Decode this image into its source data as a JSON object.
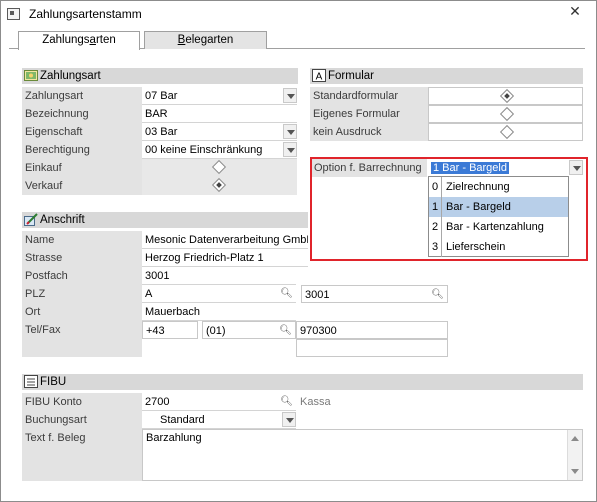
{
  "window": {
    "title": "Zahlungsartenstamm",
    "close": "✕"
  },
  "tabs": [
    {
      "label_pre": "Zahlungs",
      "label_u": "a",
      "label_post": "rten"
    },
    {
      "label_pre": "",
      "label_u": "B",
      "label_post": "elegarten"
    }
  ],
  "zahlungsart": {
    "header": "Zahlungsart",
    "zahlungsart_label": "Zahlungsart",
    "zahlungsart_value": "07 Bar",
    "bezeichnung_label": "Bezeichnung",
    "bezeichnung_value": "BAR",
    "eigenschaft_label": "Eigenschaft",
    "eigenschaft_value": "03 Bar",
    "berechtigung_label": "Berechtigung",
    "berechtigung_value": "00 keine Einschränkung",
    "einkauf_label": "Einkauf",
    "verkauf_label": "Verkauf"
  },
  "formular": {
    "header": "Formular",
    "options": [
      "Standardformular",
      "Eigenes Formular",
      "kein Ausdruck"
    ],
    "selected_index": 0,
    "barrechnung_label": "Option f. Barrechnung",
    "barrechnung_value": "1 Bar - Bargeld",
    "dropdown_items": [
      {
        "num": "0",
        "text": "Zielrechnung"
      },
      {
        "num": "1",
        "text": "Bar - Bargeld"
      },
      {
        "num": "2",
        "text": "Bar - Kartenzahlung"
      },
      {
        "num": "3",
        "text": "Lieferschein"
      }
    ],
    "dropdown_selected_index": 1
  },
  "anschrift": {
    "header": "Anschrift",
    "name_label": "Name",
    "name_value": "Mesonic Datenverarbeitung GmbH",
    "strasse_label": "Strasse",
    "strasse_value": "Herzog Friedrich-Platz 1",
    "postfach_label": "Postfach",
    "postfach_value": "3001",
    "plz_label": "PLZ",
    "plz_country": "A",
    "plz_value": "3001",
    "ort_label": "Ort",
    "ort_value": "Mauerbach",
    "telfax_label": "Tel/Fax",
    "tel_country": "+43",
    "tel_area": "(01)",
    "tel_number": "970300"
  },
  "fibu": {
    "header": "FIBU",
    "konto_label": "FIBU Konto",
    "konto_value": "2700",
    "konto_name": "Kassa",
    "buchungsart_label": "Buchungsart",
    "buchungsart_value": "Standard",
    "text_label": "Text f. Beleg",
    "text_value": "Barzahlung"
  },
  "icons": {
    "zahlungsart": "payment-card-icon",
    "formular": "letter-a-icon",
    "anschrift": "pen-address-icon",
    "fibu": "ledger-icon",
    "lookup": "magnifier-icon"
  },
  "colors": {
    "highlight": "#e0242b",
    "selection": "#b8cfe9",
    "section": "#d8d8d8"
  }
}
